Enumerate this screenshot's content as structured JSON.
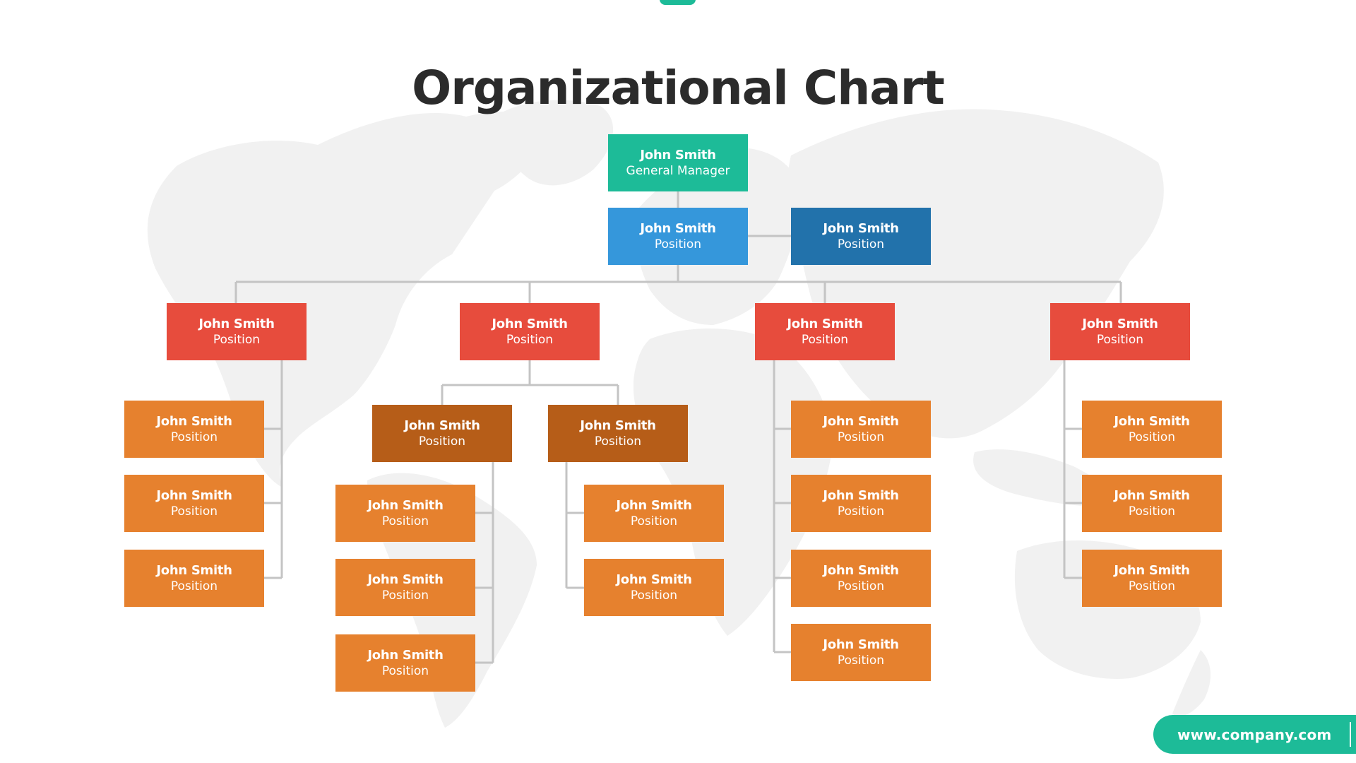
{
  "title": "Organizational Chart",
  "colors": {
    "accent": "#1dbb98",
    "general_manager": "#1dbb98",
    "assistant": "#3597db",
    "assistant_dark": "#2272ab",
    "department_head": "#e74c3d",
    "sub_manager": "#b65d18",
    "staff": "#e6812e",
    "connector": "#c4c4c4",
    "title_text": "#2b2b2b",
    "map": "#f1f1f1"
  },
  "general_manager": {
    "name": "John Smith",
    "role": "General Manager"
  },
  "assistants": [
    {
      "name": "John Smith",
      "role": "Position"
    },
    {
      "name": "John Smith",
      "role": "Position"
    }
  ],
  "departments": [
    {
      "head": {
        "name": "John Smith",
        "role": "Position"
      },
      "staff": [
        {
          "name": "John Smith",
          "role": "Position"
        },
        {
          "name": "John Smith",
          "role": "Position"
        },
        {
          "name": "John Smith",
          "role": "Position"
        }
      ]
    },
    {
      "head": {
        "name": "John Smith",
        "role": "Position"
      },
      "sub_managers": [
        {
          "manager": {
            "name": "John Smith",
            "role": "Position"
          },
          "staff": [
            {
              "name": "John Smith",
              "role": "Position"
            },
            {
              "name": "John Smith",
              "role": "Position"
            },
            {
              "name": "John Smith",
              "role": "Position"
            }
          ]
        },
        {
          "manager": {
            "name": "John Smith",
            "role": "Position"
          },
          "staff": [
            {
              "name": "John Smith",
              "role": "Position"
            },
            {
              "name": "John Smith",
              "role": "Position"
            }
          ]
        }
      ]
    },
    {
      "head": {
        "name": "John Smith",
        "role": "Position"
      },
      "staff": [
        {
          "name": "John Smith",
          "role": "Position"
        },
        {
          "name": "John Smith",
          "role": "Position"
        },
        {
          "name": "John Smith",
          "role": "Position"
        },
        {
          "name": "John Smith",
          "role": "Position"
        }
      ]
    },
    {
      "head": {
        "name": "John Smith",
        "role": "Position"
      },
      "staff": [
        {
          "name": "John Smith",
          "role": "Position"
        },
        {
          "name": "John Smith",
          "role": "Position"
        },
        {
          "name": "John Smith",
          "role": "Position"
        }
      ]
    }
  ],
  "footer": {
    "url": "www.company.com"
  }
}
